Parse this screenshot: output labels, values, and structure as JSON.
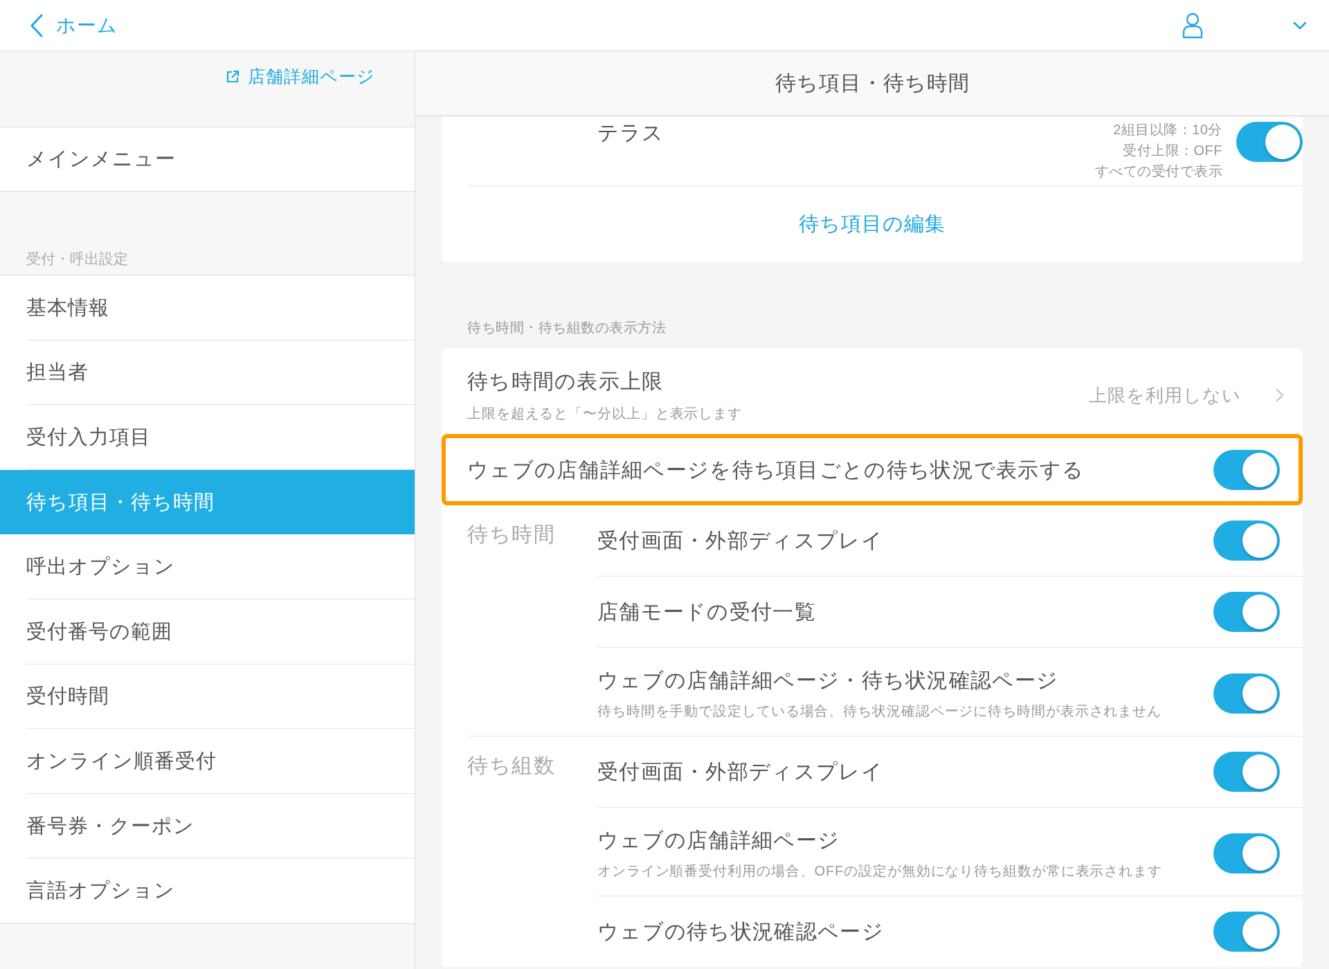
{
  "header": {
    "back_label": "ホーム"
  },
  "sidebar": {
    "store_link": "店舗詳細ページ",
    "main_menu": "メインメニュー",
    "section_title": "受付・呼出設定",
    "items": [
      {
        "label": "基本情報",
        "selected": false
      },
      {
        "label": "担当者",
        "selected": false
      },
      {
        "label": "受付入力項目",
        "selected": false
      },
      {
        "label": "待ち項目・待ち時間",
        "selected": true
      },
      {
        "label": "呼出オプション",
        "selected": false
      },
      {
        "label": "受付番号の範囲",
        "selected": false
      },
      {
        "label": "受付時間",
        "selected": false
      },
      {
        "label": "オンライン順番受付",
        "selected": false
      },
      {
        "label": "番号券・クーポン",
        "selected": false
      },
      {
        "label": "言語オプション",
        "selected": false
      }
    ]
  },
  "panel": {
    "title": "待ち項目・待ち時間"
  },
  "wait_items": {
    "item": {
      "name": "テラス",
      "details": [
        "2組目以降：10分",
        "受付上限：OFF",
        "すべての受付で表示"
      ],
      "on": true
    },
    "edit_link": "待ち項目の編集"
  },
  "display": {
    "section_title": "待ち時間・待ち組数の表示方法",
    "limit": {
      "label": "待ち時間の表示上限",
      "note": "上限を超えると「〜分以上」と表示します",
      "value": "上限を利用しない"
    },
    "per_item": {
      "label": "ウェブの店舗詳細ページを待ち項目ごとの待ち状況で表示する",
      "on": true,
      "highlighted": true
    },
    "groups": [
      {
        "label": "待ち時間",
        "rows": [
          {
            "label": "受付画面・外部ディスプレイ",
            "on": true
          },
          {
            "label": "店舗モードの受付一覧",
            "on": true
          },
          {
            "label": "ウェブの店舗詳細ページ・待ち状況確認ページ",
            "note": "待ち時間を手動で設定している場合、待ち状況確認ページに待ち時間が表示されません",
            "on": true
          }
        ]
      },
      {
        "label": "待ち組数",
        "rows": [
          {
            "label": "受付画面・外部ディスプレイ",
            "on": true
          },
          {
            "label": "ウェブの店舗詳細ページ",
            "note": "オンライン順番受付利用の場合、OFFの設定が無効になり待ち組数が常に表示されます",
            "on": true
          },
          {
            "label": "ウェブの待ち状況確認ページ",
            "on": true
          }
        ]
      }
    ]
  }
}
